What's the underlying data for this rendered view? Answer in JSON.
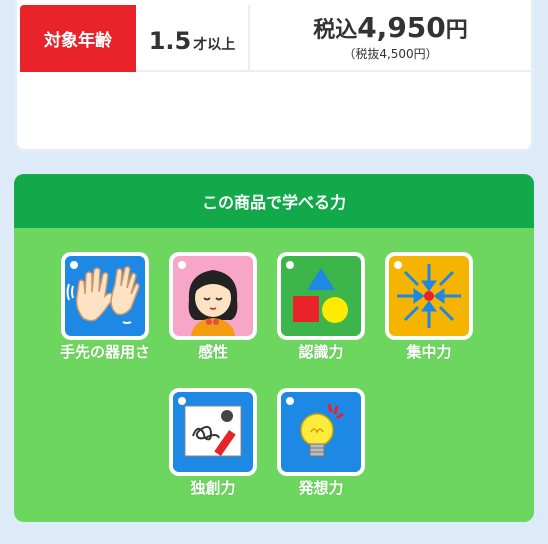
{
  "product_info": {
    "age_label": "対象年齢",
    "age_value": "1.5",
    "age_unit": "才以上",
    "price_prefix": "税込",
    "price_value": "4,950",
    "price_unit": "円",
    "price_sub": "（税抜4,500円）"
  },
  "skills": {
    "title": "この商品で学べる力",
    "items": [
      {
        "label": "手先の器用さ",
        "icon": "hands-icon",
        "color": "#1e88e5"
      },
      {
        "label": "感性",
        "icon": "girl-face-icon",
        "color": "#f7a6c8"
      },
      {
        "label": "認識力",
        "icon": "shapes-icon",
        "color": "#3cb54a"
      },
      {
        "label": "集中力",
        "icon": "focus-arrows-icon",
        "color": "#f4b400"
      },
      {
        "label": "独創力",
        "icon": "crayon-drawing-icon",
        "color": "#1e88e5"
      },
      {
        "label": "発想力",
        "icon": "lightbulb-icon",
        "color": "#1e88e5"
      }
    ]
  },
  "colors": {
    "age_label_bg": "#e8232a",
    "panel_bg": "#6dd65f",
    "panel_header_bg": "#12a94a"
  }
}
